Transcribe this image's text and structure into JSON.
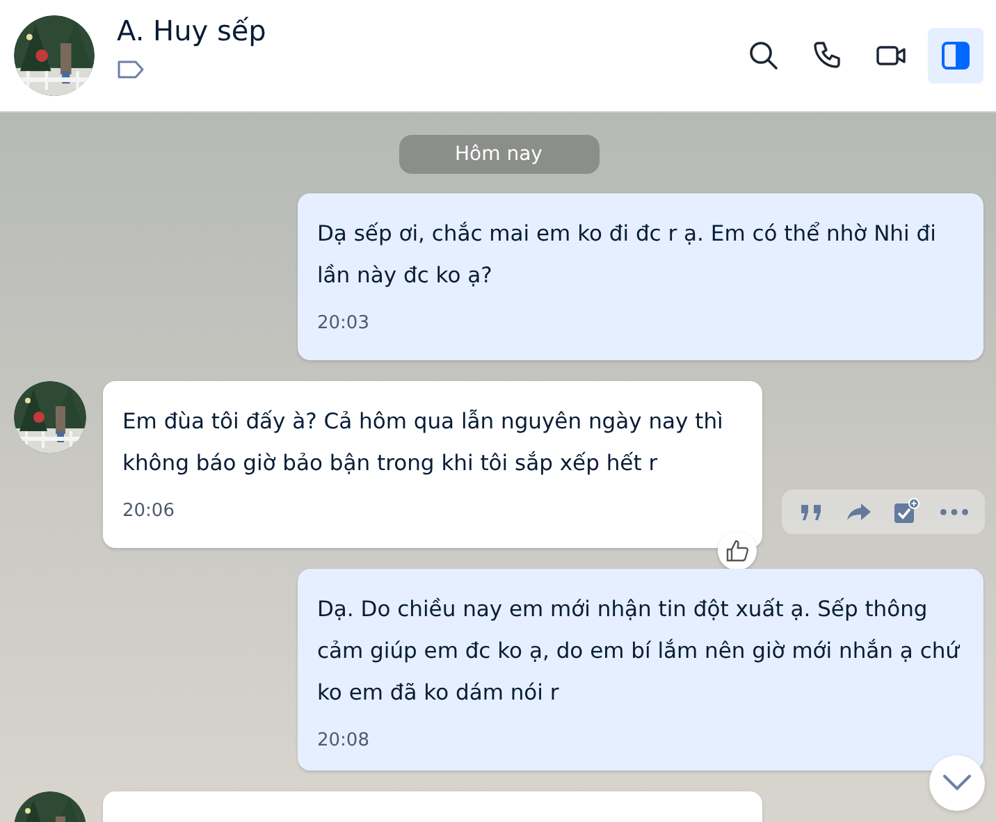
{
  "header": {
    "name": "A. Huy sếp",
    "actions": [
      {
        "kind": "search",
        "selected": false
      },
      {
        "kind": "call",
        "selected": false
      },
      {
        "kind": "video",
        "selected": false
      },
      {
        "kind": "panel",
        "selected": true
      }
    ]
  },
  "date_divider": "Hôm nay",
  "messages": [
    {
      "kind": "sent",
      "text": "Dạ sếp ơi, chắc mai em ko đi đc r ạ. Em có thể nhờ Nhi đi lần này đc ko ạ?",
      "time": "20:03",
      "hovered": false
    },
    {
      "kind": "received",
      "text": "Em đùa tôi đấy à? Cả hôm qua lẫn nguyên ngày nay thì không báo giờ bảo bận trong khi tôi sắp xếp hết r",
      "time": "20:06",
      "hovered": true
    },
    {
      "kind": "sent",
      "text": "Dạ. Do chiều nay em mới nhận tin đột xuất ạ. Sếp thông cảm giúp em đc ko ạ, do em bí lắm nên giờ mới nhắn ạ chứ ko em đã ko dám nói r",
      "time": "20:08",
      "hovered": false
    },
    {
      "kind": "received"
    }
  ]
}
